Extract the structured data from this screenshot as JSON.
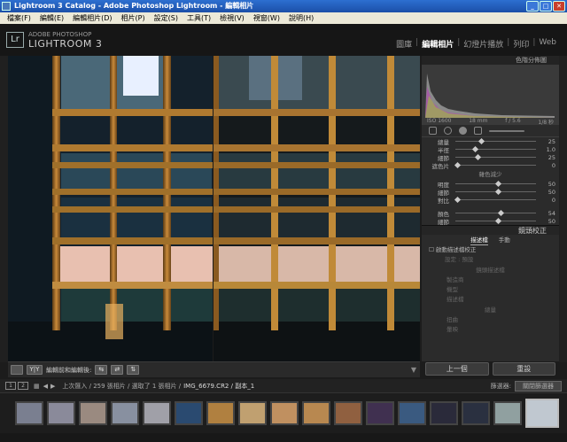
{
  "window": {
    "title": "Lightroom 3 Catalog - Adobe Photoshop Lightroom - 編輯相片"
  },
  "menu": [
    "檔案(F)",
    "編輯(E)",
    "編輯相片(D)",
    "相片(P)",
    "設定(S)",
    "工具(T)",
    "檢視(V)",
    "視窗(W)",
    "說明(H)"
  ],
  "brand": {
    "line1": "ADOBE PHOTOSHOP",
    "line2": "LIGHTROOM 3",
    "logo": "Lr"
  },
  "modules": [
    "圖庫",
    "編輯相片",
    "幻燈片播放",
    "列印",
    "Web"
  ],
  "active_module": "編輯相片",
  "right_panel": {
    "histogram_title": "色階分佈圖",
    "exif": [
      "ISO 1600",
      "18 mm",
      "f / 5.6",
      "1/8 秒"
    ],
    "sliders_top": [
      {
        "label": "總量",
        "value": "25"
      },
      {
        "label": "半徑",
        "value": "1.0"
      },
      {
        "label": "細節",
        "value": "25"
      },
      {
        "label": "遮色片",
        "value": "0"
      }
    ],
    "noise_title": "雜色減少",
    "sliders_noise": [
      {
        "label": "明度",
        "value": "50"
      },
      {
        "label": "細節",
        "value": "50"
      },
      {
        "label": "對比",
        "value": "0"
      },
      {
        "label": "顏色",
        "value": "54"
      },
      {
        "label": "細節",
        "value": "50"
      }
    ],
    "lens_title": "鏡頭校正",
    "lens_tabs": [
      "描述檔",
      "手動"
    ],
    "lens_check": "啟動描述檔校正",
    "lens_setup": "設定",
    "lens_setup_value": "預設",
    "profile_title": "鏡頭描述檔",
    "profile_fields": [
      "製造商",
      "機型",
      "描述檔"
    ],
    "amount_title": "總量",
    "amount_fields": [
      "扭曲",
      "暈映"
    ],
    "btn_prev": "上一個",
    "btn_reset": "重設"
  },
  "toolbar": {
    "label": "編輯前和編輯後:",
    "view_btn": "Y|Y"
  },
  "filmstrip_bar": {
    "pages": [
      "1",
      "2"
    ],
    "info": "上次匯入 / 259 張相片 / 選取了 1 張相片 /",
    "file": "IMG_6679.CR2 / 副本_1",
    "filter_label": "篩選器:",
    "filter_value": "關閉篩選器"
  },
  "thumbnail_count": 17
}
